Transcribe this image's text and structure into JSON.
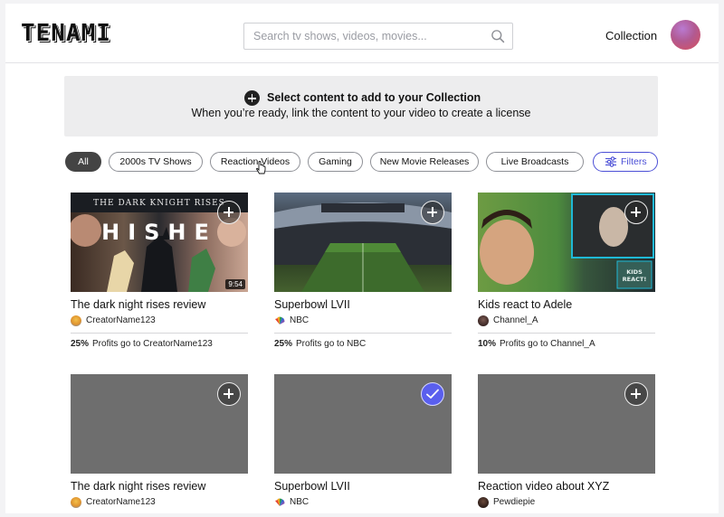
{
  "header": {
    "logo": "TENAMI",
    "search_placeholder": "Search tv shows, videos, movies...",
    "collection_label": "Collection"
  },
  "banner": {
    "title": "Select content to add to your Collection",
    "subtitle": "When you’re ready, link the content to your video to create a license"
  },
  "chips": [
    "All",
    "2000s TV Shows",
    "Reaction Videos",
    "Gaming",
    "New Movie Releases",
    "Live Broadcasts",
    "Filters"
  ],
  "cards": [
    {
      "title": "The dark night rises review",
      "creator": "CreatorName123",
      "profit_pct": "25%",
      "profit_text": "Profits go to CreatorName123",
      "duration": "9:54",
      "thumb_overlay": "THE DARK KNIGHT RISES",
      "thumb_overlay2": "HISHE",
      "selected": false
    },
    {
      "title": "Superbowl LVII",
      "creator": "NBC",
      "profit_pct": "25%",
      "profit_text": "Profits go to NBC",
      "selected": false
    },
    {
      "title": "Kids react to Adele",
      "creator": "Channel_A",
      "profit_pct": "10%",
      "profit_text": "Profits go to Channel_A",
      "thumb_overlay": "KIDS REACT!",
      "selected": false
    },
    {
      "title": "The dark night rises review",
      "creator": "CreatorName123",
      "selected": false
    },
    {
      "title": "Superbowl LVII",
      "creator": "NBC",
      "selected": true
    },
    {
      "title": "Reaction video about XYZ",
      "creator": "Pewdiepie",
      "selected": false
    }
  ],
  "colors": {
    "accent": "#5a5fee",
    "active_chip": "#444444",
    "placeholder_thumb": "#6e6e6e"
  },
  "icons": {
    "search": "search-icon",
    "add": "plus-circle-icon",
    "selected": "check-icon",
    "filters": "sliders-icon"
  }
}
